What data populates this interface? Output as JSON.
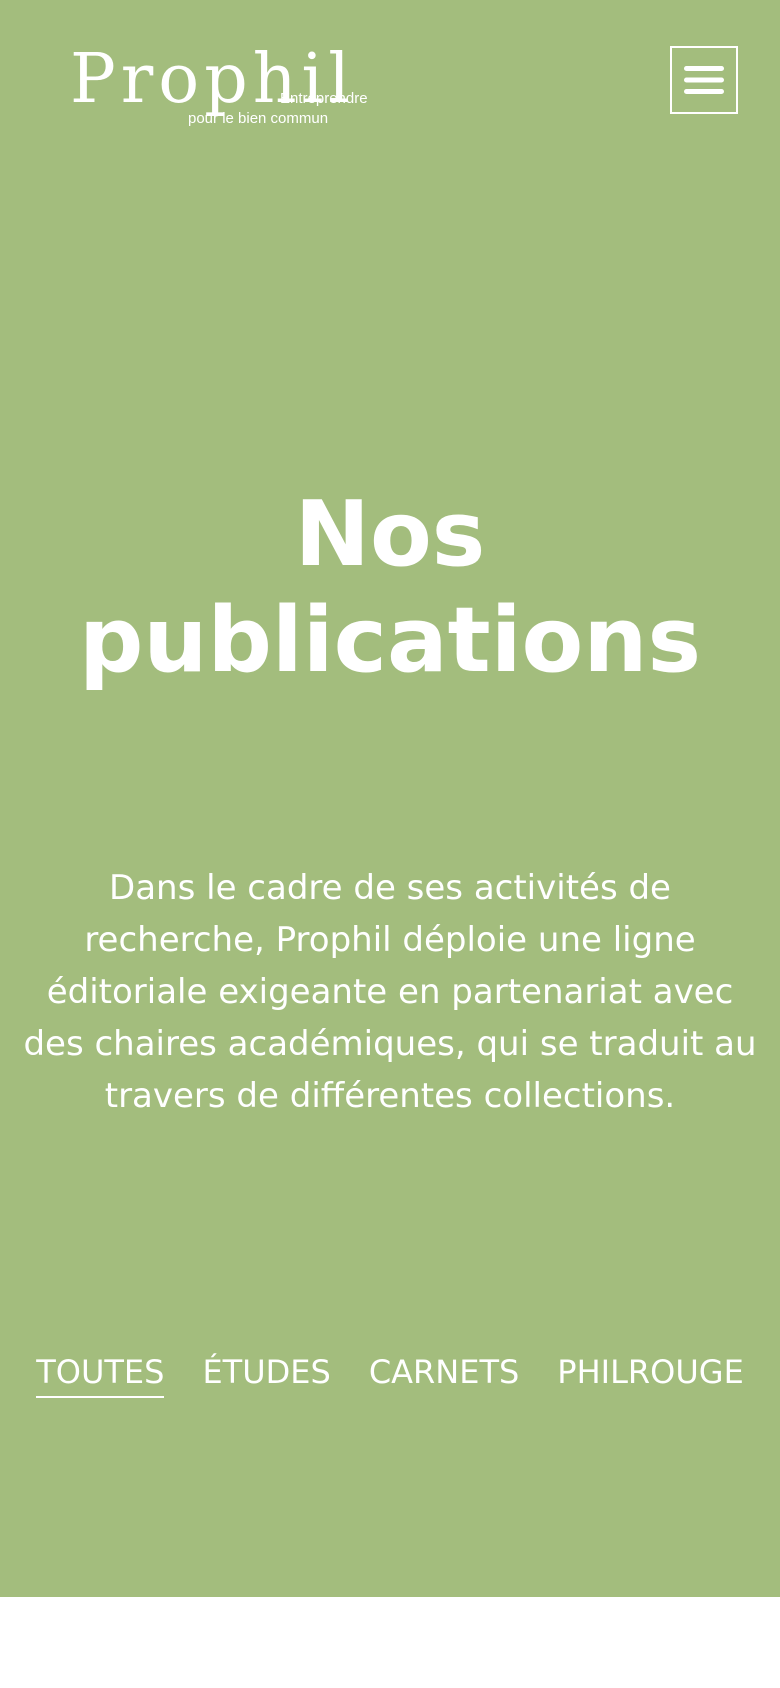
{
  "brand": {
    "name": "Prophil",
    "tagline_line1": "Entreprendre",
    "tagline_line2": "pour le bien commun"
  },
  "menu": {
    "icon": "hamburger-menu-icon"
  },
  "hero": {
    "title": "Nos publications",
    "description": "Dans le cadre de ses activités de recherche, Prophil déploie une ligne éditoriale exigeante en partenariat avec des chaires académiques, qui se traduit au travers de différentes collections."
  },
  "tabs": [
    {
      "label": "TOUTES",
      "active": true
    },
    {
      "label": "ÉTUDES",
      "active": false
    },
    {
      "label": "CARNETS",
      "active": false
    },
    {
      "label": "PHILROUGE",
      "active": false
    }
  ],
  "colors": {
    "hero_background": "#a3bd7d",
    "text": "#ffffff",
    "page_background": "#ffffff"
  }
}
